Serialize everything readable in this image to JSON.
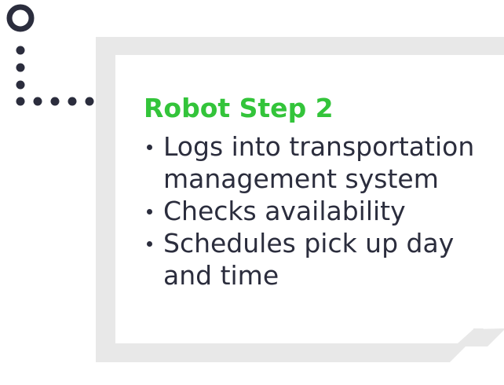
{
  "step": {
    "title": "Robot Step 2",
    "bullets": [
      "Logs into transportation management system",
      "Checks availability",
      "Schedules pick up day and time"
    ]
  },
  "colors": {
    "title": "#33c43a",
    "text": "#2b2d3d",
    "card_border": "#e8e8e8",
    "card_fill": "#ffffff",
    "connector": "#2b2d3d"
  },
  "icons": [
    "start-node-icon",
    "dotted-connector-icon"
  ]
}
